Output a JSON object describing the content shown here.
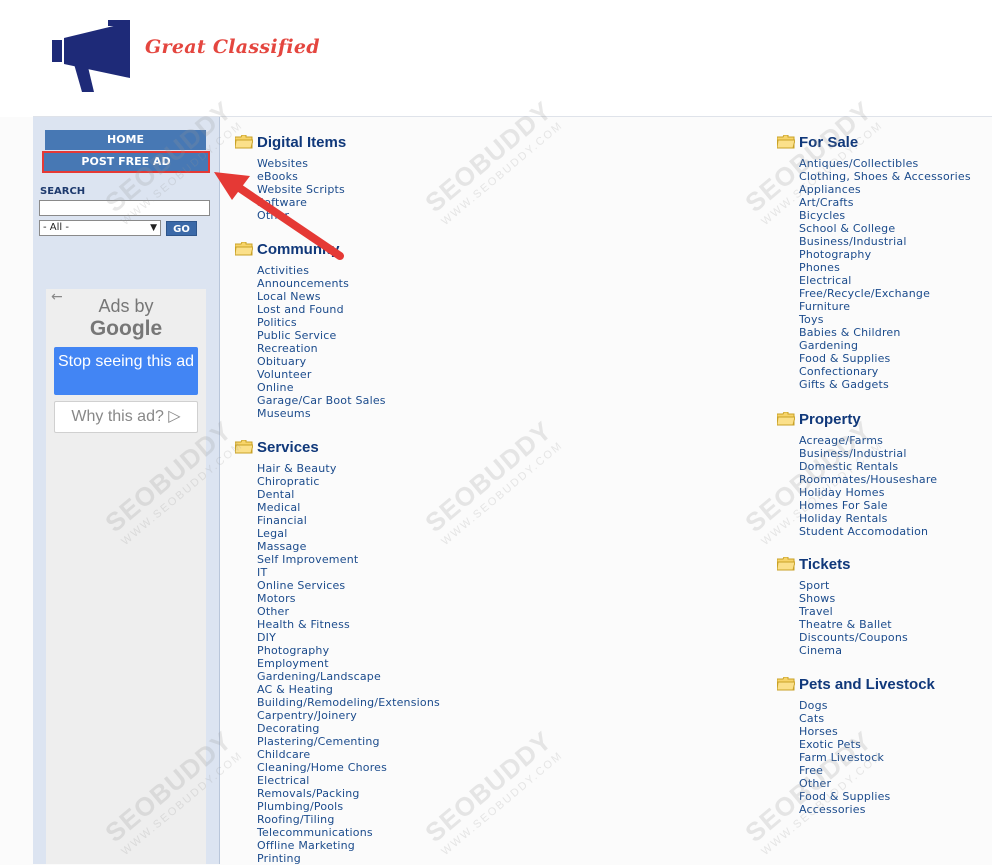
{
  "site": {
    "name": "Great Classified"
  },
  "sidebar": {
    "home_label": "HOME",
    "post_label": "POST FREE AD",
    "search_label": "SEARCH",
    "search_value": "",
    "select_value": "- All -",
    "go_label": "GO"
  },
  "ad": {
    "ads_by": "Ads by",
    "google": "Google",
    "stop_label": "Stop seeing this ad",
    "why_label": "Why this ad? ▷"
  },
  "watermark": {
    "big": "SEOBUDDY",
    "small": "WWW.SEOBUDDY.COM"
  },
  "categories": {
    "digital": {
      "title": "Digital Items",
      "items": [
        "Websites",
        "eBooks",
        "Website Scripts",
        "Software",
        "Other"
      ]
    },
    "community": {
      "title": "Community",
      "items": [
        "Activities",
        "Announcements",
        "Local News",
        "Lost and Found",
        "Politics",
        "Public Service",
        "Recreation",
        "Obituary",
        "Volunteer",
        "Online",
        "Garage/Car Boot Sales",
        "Museums"
      ]
    },
    "services": {
      "title": "Services",
      "items": [
        "Hair & Beauty",
        "Chiropratic",
        "Dental",
        "Medical",
        "Financial",
        "Legal",
        "Massage",
        "Self Improvement",
        "IT",
        "Online Services",
        "Motors",
        "Other",
        "Health & Fitness",
        "DIY",
        "Photography",
        "Employment",
        "Gardening/Landscape",
        "AC & Heating",
        "Building/Remodeling/Extensions",
        "Carpentry/Joinery",
        "Decorating",
        "Plastering/Cementing",
        "Childcare",
        "Cleaning/Home Chores",
        "Electrical",
        "Removals/Packing",
        "Plumbing/Pools",
        "Roofing/Tiling",
        "Telecommunications",
        "Offline Marketing",
        "Printing"
      ]
    },
    "forsale": {
      "title": "For Sale",
      "items": [
        "Antiques/Collectibles",
        "Clothing, Shoes & Accessories",
        "Appliances",
        "Art/Crafts",
        "Bicycles",
        "School & College",
        "Business/Industrial",
        "Photography",
        "Phones",
        "Electrical",
        "Free/Recycle/Exchange",
        "Furniture",
        "Toys",
        "Babies & Children",
        "Gardening",
        "Food & Supplies",
        "Confectionary",
        "Gifts & Gadgets"
      ]
    },
    "property": {
      "title": "Property",
      "items": [
        "Acreage/Farms",
        "Business/Industrial",
        "Domestic Rentals",
        "Roommates/Houseshare",
        "Holiday Homes",
        "Homes For Sale",
        "Holiday Rentals",
        "Student Accomodation"
      ]
    },
    "tickets": {
      "title": "Tickets",
      "items": [
        "Sport",
        "Shows",
        "Travel",
        "Theatre & Ballet",
        "Discounts/Coupons",
        "Cinema"
      ]
    },
    "pets": {
      "title": "Pets and Livestock",
      "items": [
        "Dogs",
        "Cats",
        "Horses",
        "Exotic Pets",
        "Farm Livestock",
        "Free",
        "Other",
        "Food & Supplies",
        "Accessories"
      ]
    }
  },
  "colors": {
    "brand": "#1e2a78",
    "accent": "#e4463f",
    "nav": "#4778b4",
    "link": "#1b4b8c",
    "annotation": "#e53935"
  }
}
